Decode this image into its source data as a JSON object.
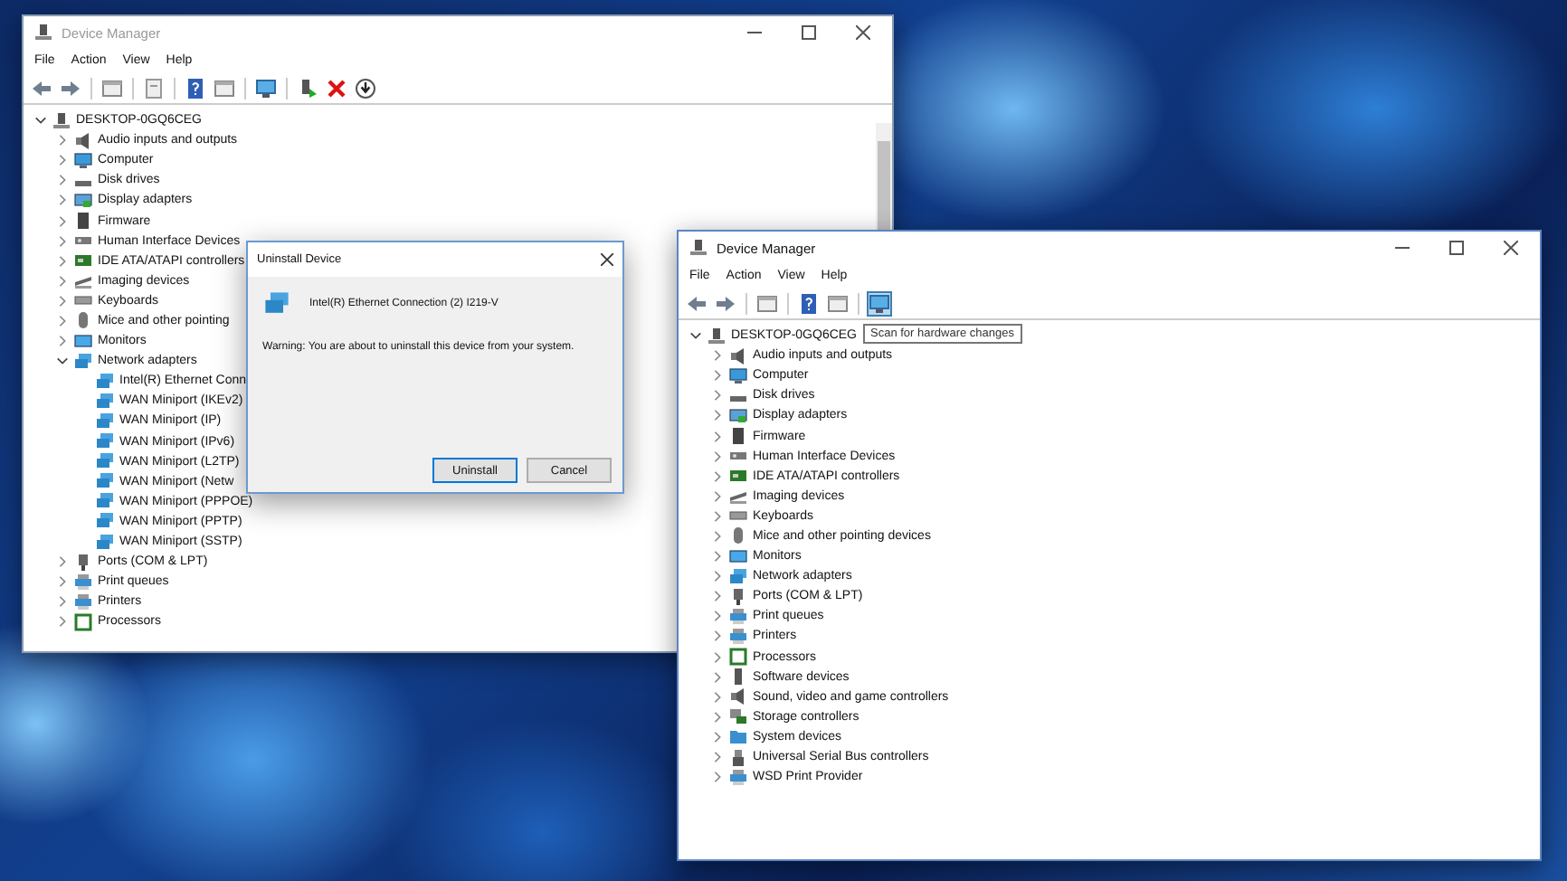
{
  "windows": [
    {
      "title": "Device Manager",
      "active": false,
      "menu": [
        "File",
        "Action",
        "View",
        "Help"
      ],
      "toolbar": [
        {
          "kind": "back",
          "hovered": false
        },
        {
          "kind": "forward",
          "hovered": false
        },
        {
          "kind": "separator"
        },
        {
          "kind": "view",
          "hovered": false
        },
        {
          "kind": "separator"
        },
        {
          "kind": "properties",
          "hovered": false
        },
        {
          "kind": "separator"
        },
        {
          "kind": "help",
          "hovered": false
        },
        {
          "kind": "view",
          "hovered": false
        },
        {
          "kind": "separator"
        },
        {
          "kind": "scan",
          "hovered": false
        },
        {
          "kind": "separator"
        },
        {
          "kind": "enable",
          "hovered": false
        },
        {
          "kind": "uninstall",
          "hovered": false
        },
        {
          "kind": "update",
          "hovered": false
        }
      ],
      "tree": {
        "label": "DESKTOP-0GQ6CEG",
        "kind": "host",
        "expanded": true,
        "children": [
          {
            "label": "Audio inputs and outputs",
            "kind": "audio",
            "expanded": false
          },
          {
            "label": "Computer",
            "kind": "computer",
            "expanded": false
          },
          {
            "label": "Disk drives",
            "kind": "disk",
            "expanded": false
          },
          {
            "label": "Display adapters",
            "kind": "display",
            "expanded": false
          },
          {
            "label": "Firmware",
            "kind": "firmware",
            "expanded": false
          },
          {
            "label": "Human Interface Devices",
            "kind": "hid",
            "expanded": false
          },
          {
            "label": "IDE ATA/ATAPI controllers",
            "kind": "ide",
            "expanded": false
          },
          {
            "label": "Imaging devices",
            "kind": "imaging",
            "expanded": false
          },
          {
            "label": "Keyboards",
            "kind": "keyboard",
            "expanded": false
          },
          {
            "label": "Mice and other pointing",
            "kind": "mouse",
            "expanded": false
          },
          {
            "label": "Monitors",
            "kind": "monitor",
            "expanded": false
          },
          {
            "label": "Network adapters",
            "kind": "network",
            "expanded": true,
            "children": [
              {
                "label": "Intel(R) Ethernet Conn",
                "kind": "network"
              },
              {
                "label": "WAN Miniport (IKEv2)",
                "kind": "network"
              },
              {
                "label": "WAN Miniport (IP)",
                "kind": "network"
              },
              {
                "label": "WAN Miniport (IPv6)",
                "kind": "network"
              },
              {
                "label": "WAN Miniport (L2TP)",
                "kind": "network"
              },
              {
                "label": "WAN Miniport (Netw",
                "kind": "network"
              },
              {
                "label": "WAN Miniport (PPPOE)",
                "kind": "network"
              },
              {
                "label": "WAN Miniport (PPTP)",
                "kind": "network"
              },
              {
                "label": "WAN Miniport (SSTP)",
                "kind": "network"
              }
            ]
          },
          {
            "label": "Ports (COM & LPT)",
            "kind": "port",
            "expanded": false
          },
          {
            "label": "Print queues",
            "kind": "printer",
            "expanded": false
          },
          {
            "label": "Printers",
            "kind": "printer",
            "expanded": false
          },
          {
            "label": "Processors",
            "kind": "processor",
            "expanded": false
          }
        ]
      }
    },
    {
      "title": "Device Manager",
      "active": true,
      "menu": [
        "File",
        "Action",
        "View",
        "Help"
      ],
      "toolbar": [
        {
          "kind": "back",
          "hovered": false
        },
        {
          "kind": "forward",
          "hovered": false
        },
        {
          "kind": "separator"
        },
        {
          "kind": "view",
          "hovered": false
        },
        {
          "kind": "separator"
        },
        {
          "kind": "help",
          "hovered": false
        },
        {
          "kind": "view",
          "hovered": false
        },
        {
          "kind": "separator"
        },
        {
          "kind": "scan",
          "hovered": true
        }
      ],
      "tooltip": "Scan for hardware changes",
      "tree": {
        "label": "DESKTOP-0GQ6CEG",
        "kind": "host",
        "expanded": true,
        "children": [
          {
            "label": "Audio inputs and outputs",
            "kind": "audio",
            "expanded": false
          },
          {
            "label": "Computer",
            "kind": "computer",
            "expanded": false
          },
          {
            "label": "Disk drives",
            "kind": "disk",
            "expanded": false
          },
          {
            "label": "Display adapters",
            "kind": "display",
            "expanded": false
          },
          {
            "label": "Firmware",
            "kind": "firmware",
            "expanded": false
          },
          {
            "label": "Human Interface Devices",
            "kind": "hid",
            "expanded": false
          },
          {
            "label": "IDE ATA/ATAPI controllers",
            "kind": "ide",
            "expanded": false
          },
          {
            "label": "Imaging devices",
            "kind": "imaging",
            "expanded": false
          },
          {
            "label": "Keyboards",
            "kind": "keyboard",
            "expanded": false
          },
          {
            "label": "Mice and other pointing devices",
            "kind": "mouse",
            "expanded": false
          },
          {
            "label": "Monitors",
            "kind": "monitor",
            "expanded": false
          },
          {
            "label": "Network adapters",
            "kind": "network",
            "expanded": false
          },
          {
            "label": "Ports (COM & LPT)",
            "kind": "port",
            "expanded": false
          },
          {
            "label": "Print queues",
            "kind": "printer",
            "expanded": false
          },
          {
            "label": "Printers",
            "kind": "printer",
            "expanded": false
          },
          {
            "label": "Processors",
            "kind": "processor",
            "expanded": false
          },
          {
            "label": "Software devices",
            "kind": "software",
            "expanded": false
          },
          {
            "label": "Sound, video and game controllers",
            "kind": "audio",
            "expanded": false
          },
          {
            "label": "Storage controllers",
            "kind": "storage",
            "expanded": false
          },
          {
            "label": "System devices",
            "kind": "system",
            "expanded": false
          },
          {
            "label": "Universal Serial Bus controllers",
            "kind": "usb",
            "expanded": false
          },
          {
            "label": "WSD Print Provider",
            "kind": "printer",
            "expanded": false
          }
        ]
      }
    }
  ],
  "dialog": {
    "title": "Uninstall Device",
    "device": "Intel(R) Ethernet Connection (2) I219-V",
    "warning": "Warning: You are about to uninstall this device from your system.",
    "buttons": [
      {
        "label": "Uninstall",
        "default": true
      },
      {
        "label": "Cancel",
        "default": false
      }
    ]
  }
}
